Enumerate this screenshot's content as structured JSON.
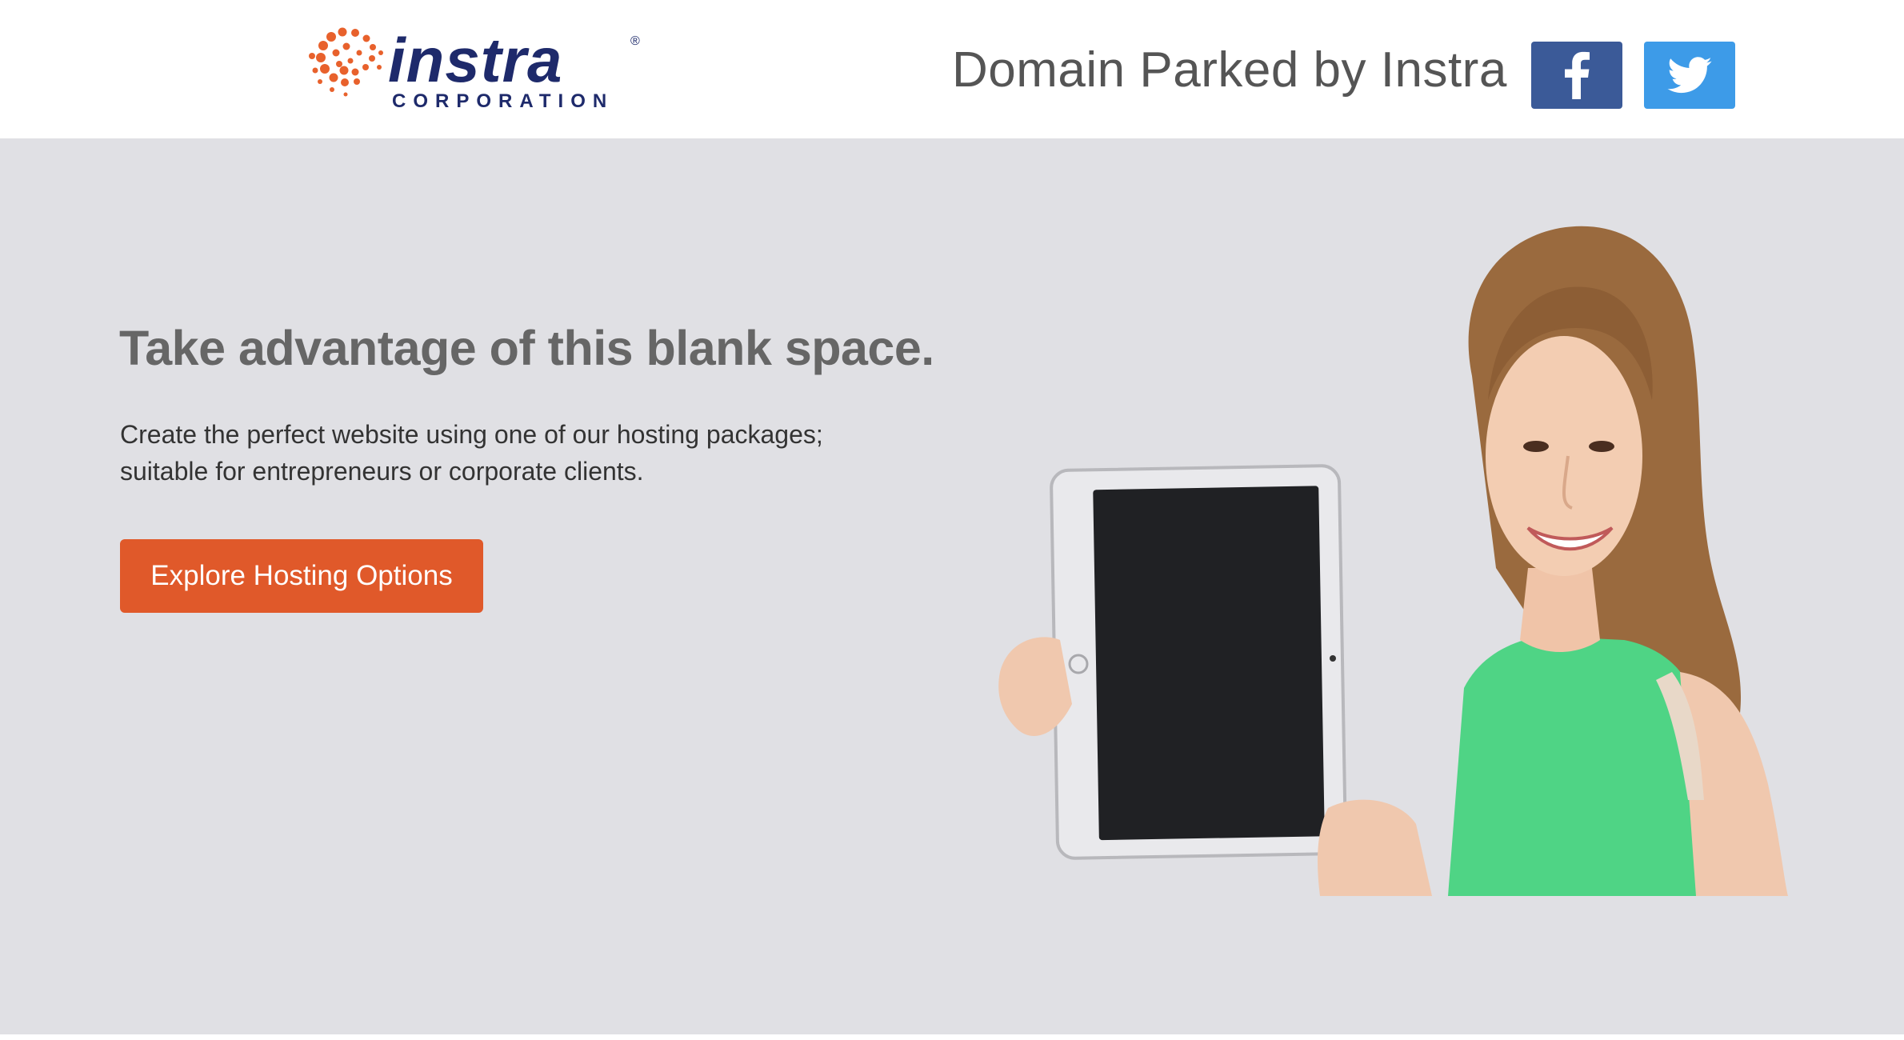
{
  "header": {
    "logo": {
      "name": "instra",
      "tagline": "CORPORATION",
      "trademark": "®"
    },
    "title": "Domain Parked by Instra",
    "social": [
      {
        "name": "facebook",
        "icon": "facebook-icon",
        "color": "#3b5a98"
      },
      {
        "name": "twitter",
        "icon": "twitter-icon",
        "color": "#3d9be8"
      }
    ]
  },
  "hero": {
    "headline": "Take advantage of this blank space.",
    "subtext_lines": [
      "Create the perfect website using one of our hosting packages;",
      "suitable for entrepreneurs or corporate clients."
    ],
    "cta_label": "Explore Hosting Options"
  },
  "colors": {
    "brand_navy": "#1e2a6b",
    "brand_orange": "#e8612c",
    "cta": "#e0592a",
    "hero_bg": "#e0e0e4",
    "tablet_screen": "#202124",
    "shirt_green": "#4fd485"
  }
}
